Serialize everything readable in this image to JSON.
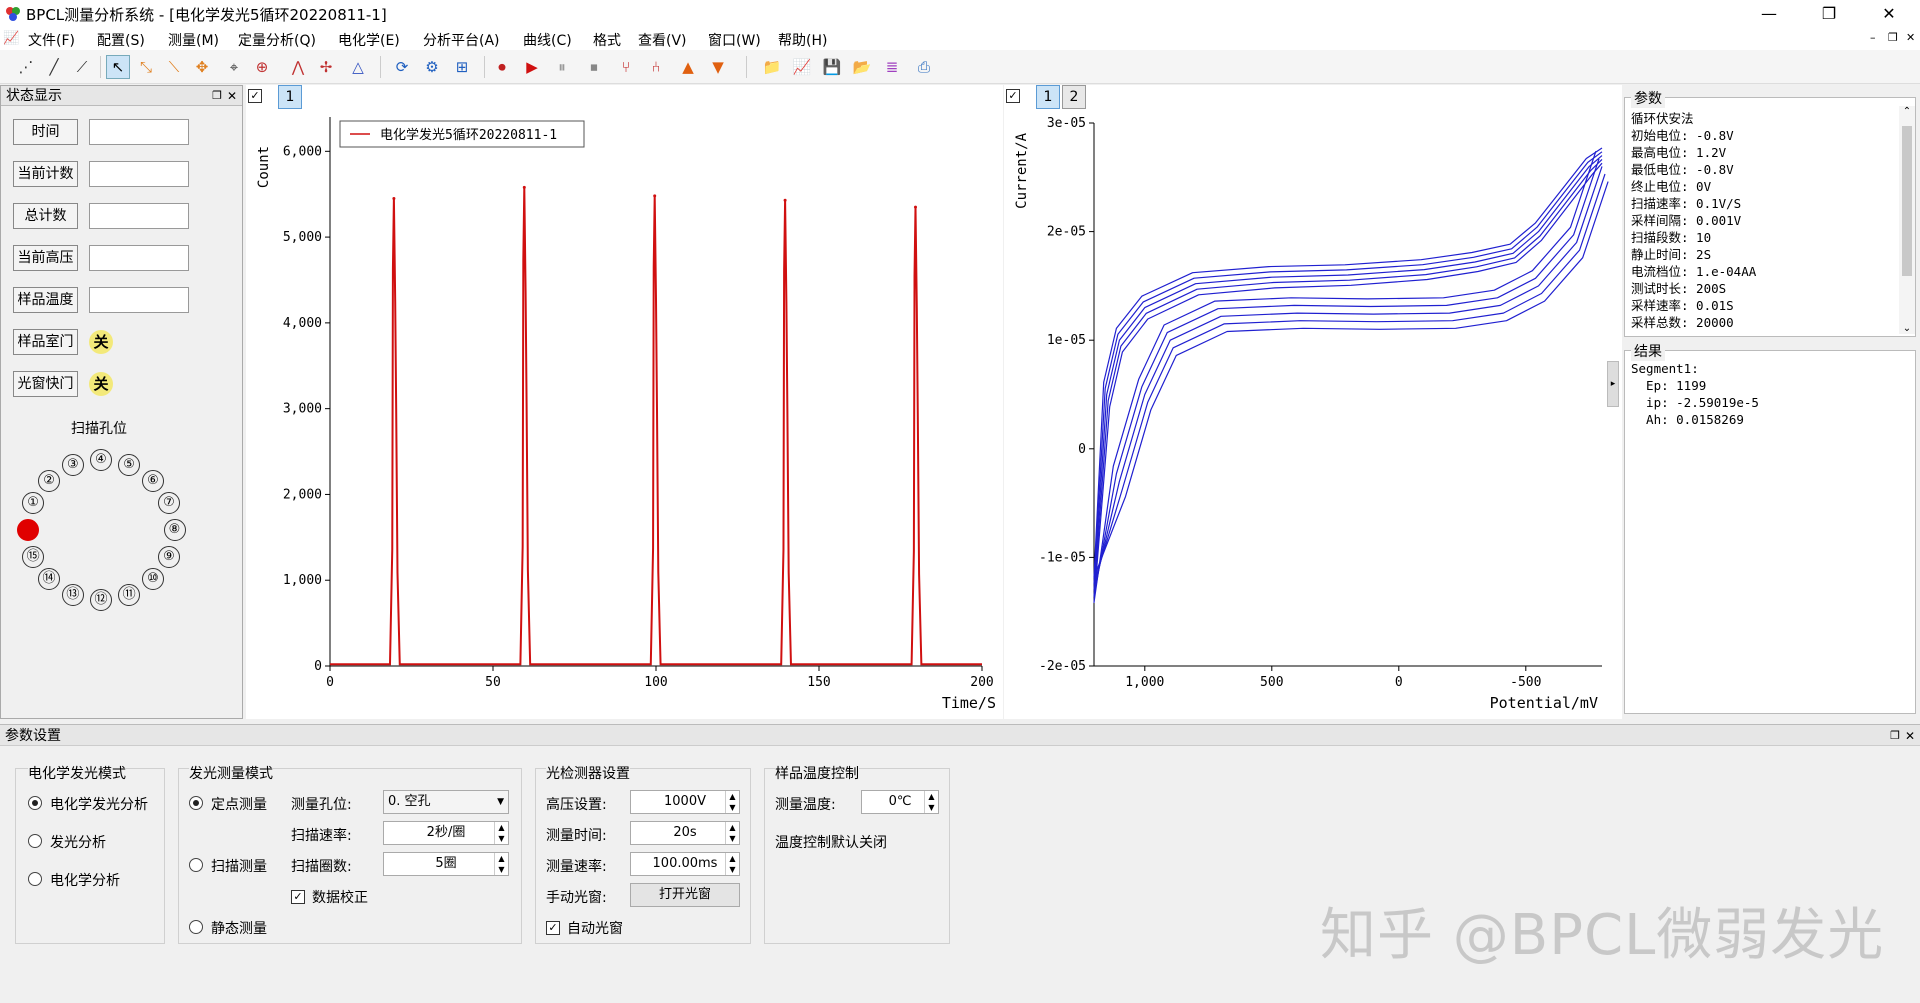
{
  "window": {
    "title": "BPCL测量分析系统 - [电化学发光5循环20220811-1]"
  },
  "menu": [
    "文件(F)",
    "配置(S)",
    "测量(M)",
    "定量分析(Q)",
    "电化学(E)",
    "分析平台(A)",
    "曲线(C)",
    "格式",
    "查看(V)",
    "窗口(W)",
    "帮助(H)"
  ],
  "status_panel": {
    "title": "状态显示",
    "fields": [
      {
        "label": "时间",
        "value": ""
      },
      {
        "label": "当前计数",
        "value": ""
      },
      {
        "label": "总计数",
        "value": ""
      },
      {
        "label": "当前高压",
        "value": ""
      },
      {
        "label": "样品温度",
        "value": ""
      }
    ],
    "toggles": [
      {
        "label": "样品室门",
        "value": "关"
      },
      {
        "label": "光窗快门",
        "value": "关"
      }
    ],
    "scan_title": "扫描孔位",
    "holes": [
      "①",
      "②",
      "③",
      "④",
      "⑤",
      "⑥",
      "⑦",
      "⑧",
      "⑨",
      "⑩",
      "⑪",
      "⑫",
      "⑬",
      "⑭",
      "⑮"
    ],
    "active_hole_color": "#e00000"
  },
  "chart1": {
    "tab": "1",
    "legend": "电化学发光5循环20220811-1",
    "ylabel": "Count",
    "xlabel": "Time/S",
    "yticks": [
      "0",
      "1,000",
      "2,000",
      "3,000",
      "4,000",
      "5,000",
      "6,000"
    ],
    "xticks": [
      "0",
      "50",
      "100",
      "150",
      "200"
    ],
    "line_color": "#d01010"
  },
  "chart_data": [
    {
      "type": "line",
      "ylabel": "Count",
      "xlabel": "Time/S",
      "xlim": [
        0,
        200
      ],
      "ylim": [
        0,
        6400
      ],
      "series": [
        {
          "name": "电化学发光5循环20220811-1",
          "peaks": [
            {
              "x": 20,
              "y": 5450
            },
            {
              "x": 60,
              "y": 5580
            },
            {
              "x": 100,
              "y": 5480
            },
            {
              "x": 140,
              "y": 5430
            },
            {
              "x": 180,
              "y": 5350
            }
          ],
          "baseline": 20
        }
      ],
      "grid": false,
      "legend": "top-left"
    },
    {
      "type": "line",
      "ylabel": "Current/A",
      "xlabel": "Potential/mV",
      "xlim": [
        1200,
        -800
      ],
      "ylim": [
        -2e-05,
        3e-05
      ],
      "x_reversed": true,
      "color": "#2020d0",
      "cycles": 5,
      "upper_branch": [
        [
          -800,
          2.7e-05
        ],
        [
          -750,
          2.6e-05
        ],
        [
          -650,
          2.3e-05
        ],
        [
          -550,
          2e-05
        ],
        [
          -450,
          1.8e-05
        ],
        [
          -300,
          1.72e-05
        ],
        [
          -100,
          1.65e-05
        ],
        [
          200,
          1.6e-05
        ],
        [
          500,
          1.58e-05
        ],
        [
          800,
          1.52e-05
        ],
        [
          1000,
          1.3e-05
        ],
        [
          1100,
          1e-05
        ],
        [
          1150,
          5e-06
        ],
        [
          1200,
          -1.3e-05
        ]
      ],
      "lower_branch": [
        [
          1200,
          -1.3e-05
        ],
        [
          1100,
          -3e-06
        ],
        [
          1000,
          5e-06
        ],
        [
          900,
          1e-05
        ],
        [
          700,
          1.22e-05
        ],
        [
          400,
          1.25e-05
        ],
        [
          100,
          1.24e-05
        ],
        [
          -200,
          1.25e-05
        ],
        [
          -400,
          1.32e-05
        ],
        [
          -550,
          1.5e-05
        ],
        [
          -700,
          1.9e-05
        ],
        [
          -800,
          2.6e-05
        ]
      ],
      "grid": false
    }
  ],
  "chart2": {
    "tabs": [
      "1",
      "2"
    ],
    "ylabel": "Current/A",
    "xlabel": "Potential/mV",
    "yticks": [
      "-2e-05",
      "-1e-05",
      "0",
      "1e-05",
      "2e-05",
      "3e-05"
    ],
    "xticks": [
      "1,000",
      "500",
      "0",
      "-500"
    ],
    "line_color": "#2020d0"
  },
  "params": {
    "title": "参数",
    "lines": [
      "循环伏安法",
      "初始电位: -0.8V",
      "最高电位: 1.2V",
      "最低电位: -0.8V",
      "终止电位: 0V",
      "扫描速率: 0.1V/S",
      "采样间隔: 0.001V",
      "扫描段数: 10",
      "静止时间: 2S",
      "电流档位: 1.e-04AA",
      "测试时长: 200S",
      "采样速率: 0.01S",
      "采样总数: 20000"
    ]
  },
  "results": {
    "title": "结果",
    "lines": [
      "Segment1:",
      "  Ep: 1199",
      "  ip: -2.59019e-5",
      "  Ah: 0.0158269"
    ]
  },
  "bottom": {
    "title": "参数设置",
    "ecl_mode": {
      "title": "电化学发光模式",
      "options": [
        "电化学发光分析",
        "发光分析",
        "电化学分析"
      ],
      "selected": 0
    },
    "lum_mode": {
      "title": "发光测量模式",
      "options": [
        "定点测量",
        "扫描测量",
        "静态测量"
      ],
      "selected": 0,
      "hole_label": "测量孔位:",
      "hole_value": "0. 空孔",
      "speed_label": "扫描速率:",
      "speed_value": "2秒/圈",
      "count_label": "扫描圈数:",
      "count_value": "5圈",
      "calib_label": "数据校正"
    },
    "detector": {
      "title": "光检测器设置",
      "hv_label": "高压设置:",
      "hv_value": "1000V",
      "time_label": "测量时间:",
      "time_value": "20s",
      "rate_label": "测量速率:",
      "rate_value": "100.00ms",
      "manual_label": "手动光窗:",
      "manual_button": "打开光窗",
      "auto_label": "自动光窗"
    },
    "temp": {
      "title": "样品温度控制",
      "temp_label": "测量温度:",
      "temp_value": "0℃",
      "note": "温度控制默认关闭"
    }
  },
  "watermark": "知乎 @BPCL微弱发光"
}
